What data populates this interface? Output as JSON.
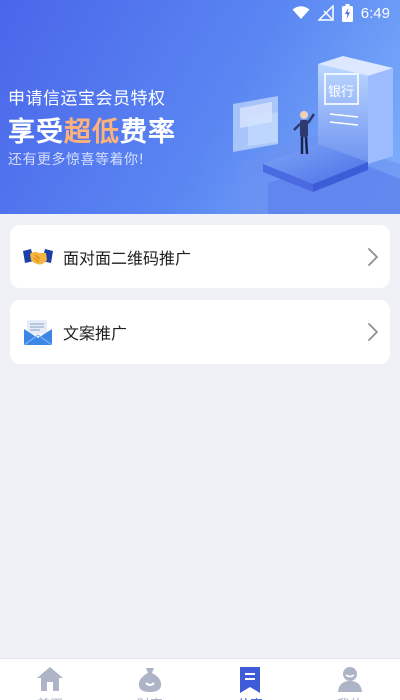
{
  "status_bar": {
    "time": "6:49"
  },
  "banner": {
    "line1": "申请信运宝会员特权",
    "line2_prefix": "享受",
    "line2_highlight": "超低",
    "line2_suffix": "费率",
    "line3": "还有更多惊喜等着你!",
    "illustration_sign": "银行"
  },
  "cards": [
    {
      "label": "面对面二维码推广",
      "icon": "handshake-icon"
    },
    {
      "label": "文案推广",
      "icon": "envelope-icon"
    }
  ],
  "bottom_nav": {
    "items": [
      {
        "label": "首页",
        "icon": "home-icon",
        "active": false
      },
      {
        "label": "财富",
        "icon": "money-bag-icon",
        "active": false
      },
      {
        "label": "分享",
        "icon": "bookmark-icon",
        "active": true
      },
      {
        "label": "我的",
        "icon": "user-icon",
        "active": false
      }
    ]
  },
  "colors": {
    "accent": "#3e5bd9",
    "banner_start": "#4a66ea",
    "banner_end": "#7fb2fb",
    "highlight": "#ffb27a",
    "nav_inactive": "#a8acc0"
  }
}
